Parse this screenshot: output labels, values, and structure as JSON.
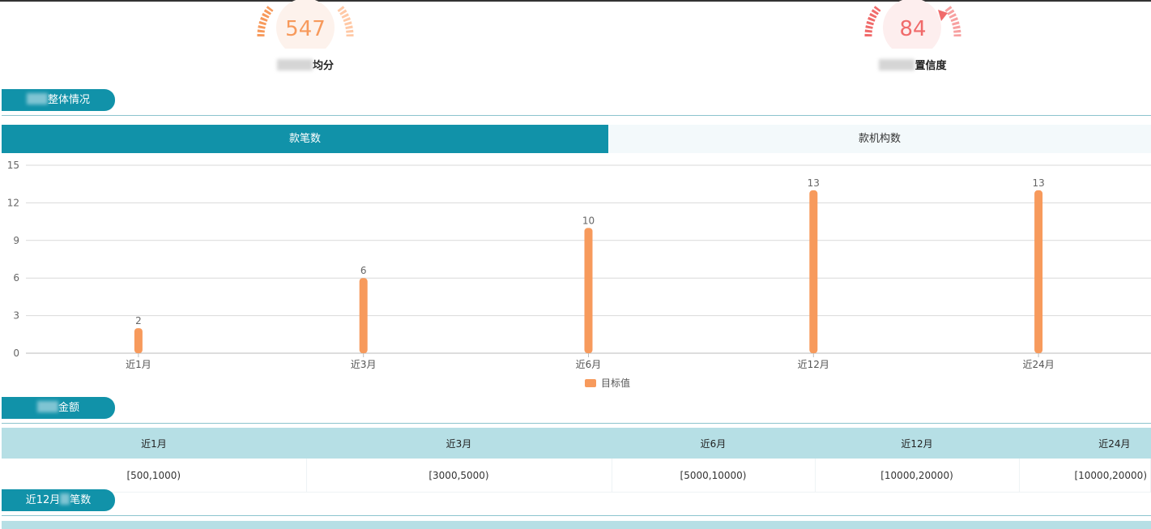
{
  "gauges": [
    {
      "value": "547",
      "label_suffix": "均分",
      "color": "#f79a5c"
    },
    {
      "value": "84",
      "label_suffix": "置信度",
      "color": "#f06a6a"
    }
  ],
  "sections": {
    "overall": "整体情况",
    "amount": "金额",
    "count12": "近12月",
    "count12_suffix": "笔数"
  },
  "tabs": [
    {
      "label": "款笔数",
      "active": true
    },
    {
      "label": "款机构数",
      "active": false
    }
  ],
  "chart_data": {
    "type": "bar",
    "categories": [
      "近1月",
      "近3月",
      "近6月",
      "近12月",
      "近24月"
    ],
    "series": [
      {
        "name": "目标值",
        "values": [
          2,
          6,
          10,
          13,
          13
        ],
        "color": "#f79a5c"
      }
    ],
    "y_ticks": [
      "0",
      "3",
      "6",
      "9",
      "12",
      "15"
    ],
    "ylim": [
      0,
      15
    ],
    "grid": true,
    "legend_placement": "bottom-center"
  },
  "amount_table": {
    "headers": [
      "近1月",
      "近3月",
      "近6月",
      "近12月",
      "近24月"
    ],
    "rows": [
      [
        "[500,1000)",
        "[3000,5000)",
        "[5000,10000)",
        "[10000,20000)",
        "[10000,20000)"
      ]
    ]
  }
}
